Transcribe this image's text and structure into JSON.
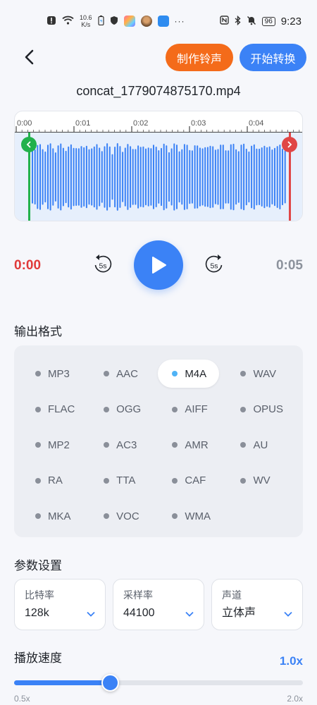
{
  "status_bar": {
    "net_speed_value": "10.6",
    "net_speed_unit": "K/s",
    "battery": "96",
    "time": "9:23",
    "overflow": "···"
  },
  "header": {
    "back_icon": "chevron-left-icon",
    "ringtone_label": "制作铃声",
    "convert_label": "开始转换"
  },
  "file": {
    "name": "concat_1779074875170.mp4"
  },
  "waveform": {
    "ticks": [
      "0:00",
      "0:01",
      "0:02",
      "0:03",
      "0:04"
    ],
    "selection_start_fraction": 0.05,
    "selection_end_fraction": 0.955,
    "bar_color": "#3b82f6",
    "start_handle_color": "#22b14c",
    "end_handle_color": "#e04646"
  },
  "playback": {
    "current_time": "0:00",
    "total_time": "0:05",
    "rewind_label": "5s",
    "forward_label": "5s"
  },
  "output_format": {
    "title": "输出格式",
    "options": [
      "MP3",
      "AAC",
      "M4A",
      "WAV",
      "FLAC",
      "OGG",
      "AIFF",
      "OPUS",
      "MP2",
      "AC3",
      "AMR",
      "AU",
      "RA",
      "TTA",
      "CAF",
      "WV",
      "MKA",
      "VOC",
      "WMA"
    ],
    "selected": "M4A"
  },
  "params": {
    "title": "参数设置",
    "items": [
      {
        "label": "比特率",
        "value": "128k"
      },
      {
        "label": "采样率",
        "value": "44100"
      },
      {
        "label": "声道",
        "value": "立体声"
      }
    ]
  },
  "speed": {
    "title": "播放速度",
    "value": "1.0x",
    "min": "0.5x",
    "max": "2.0x",
    "fraction": 0.333
  },
  "colors": {
    "accent": "#3b82f6",
    "ringtone": "#f46b1a",
    "time_current": "#e03a3a"
  }
}
